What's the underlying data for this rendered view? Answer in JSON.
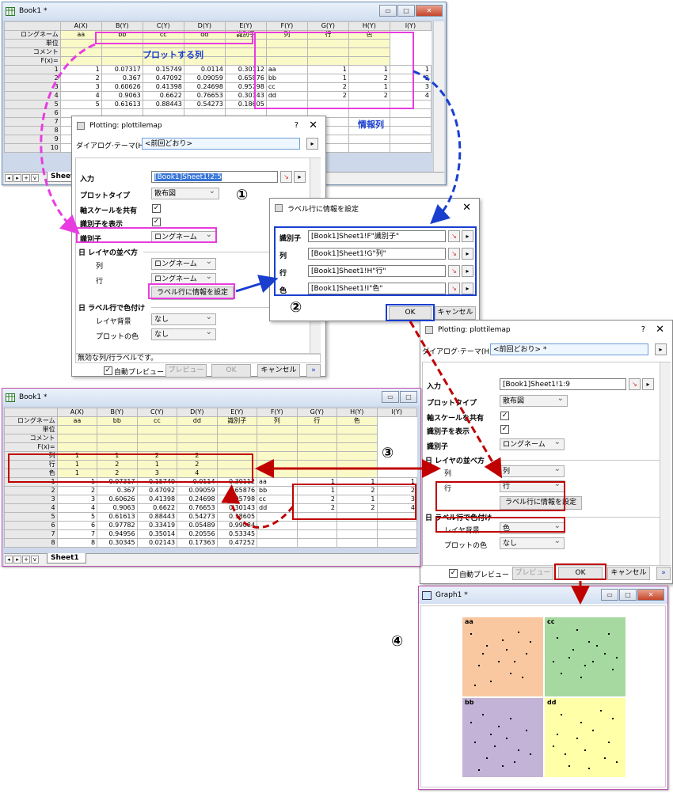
{
  "book_top": {
    "title": "Book1 *",
    "columns": [
      "",
      "A(X)",
      "B(Y)",
      "C(Y)",
      "D(Y)",
      "E(Y)",
      "F(Y)",
      "G(Y)",
      "H(Y)",
      "I(Y)"
    ],
    "meta": [
      {
        "label": "ロングネーム",
        "values": [
          "",
          "aa",
          "bb",
          "cc",
          "dd",
          "識別子",
          "列",
          "行",
          "色"
        ]
      },
      {
        "label": "単位",
        "values": [
          "",
          "",
          "",
          "",
          "",
          "",
          "",
          "",
          ""
        ]
      },
      {
        "label": "コメント",
        "values": [
          "",
          "",
          "",
          "",
          "",
          "",
          "",
          "",
          ""
        ]
      },
      {
        "label": "F(x)=",
        "values": [
          "",
          "",
          "",
          "",
          "",
          "",
          "",
          "",
          ""
        ]
      }
    ],
    "rows": [
      [
        "1",
        "1",
        "0.07317",
        "0.15749",
        "0.0114",
        "0.30112",
        "aa",
        "1",
        "1",
        "1"
      ],
      [
        "2",
        "2",
        "0.367",
        "0.47092",
        "0.09059",
        "0.65876",
        "bb",
        "1",
        "2",
        "2"
      ],
      [
        "3",
        "3",
        "0.60626",
        "0.41398",
        "0.24698",
        "0.95798",
        "cc",
        "2",
        "1",
        "3"
      ],
      [
        "4",
        "4",
        "0.9063",
        "0.6622",
        "0.76653",
        "0.30143",
        "dd",
        "2",
        "2",
        "4"
      ],
      [
        "5",
        "5",
        "0.61613",
        "0.88443",
        "0.54273",
        "0.18605",
        "",
        "",
        "",
        ""
      ],
      [
        "6",
        "",
        "",
        "",
        "",
        "",
        "",
        "",
        "",
        ""
      ],
      [
        "7",
        "",
        "",
        "",
        "",
        "",
        "",
        "",
        "",
        ""
      ],
      [
        "8",
        "",
        "",
        "",
        "",
        "",
        "",
        "",
        "",
        ""
      ],
      [
        "9",
        "",
        "",
        "",
        "",
        "",
        "",
        "",
        "",
        ""
      ],
      [
        "10",
        "",
        "",
        "",
        "",
        "",
        "",
        "",
        "",
        ""
      ]
    ],
    "tab": "Sheet1",
    "ann_plot": "プロットする列",
    "ann_info": "情報列"
  },
  "dlg1": {
    "title": "Plotting: plottilemap",
    "theme_label": "ダイアログ·テーマ(H)",
    "theme_value": "<前回どおり>",
    "input_label": "入力",
    "input_value": "[Book1]Sheet1!2:5",
    "plottype_label": "プロットタイプ",
    "plottype_value": "散布図",
    "share_label": "軸スケールを共有",
    "show_label": "識別子を表示",
    "ident_label": "識別子",
    "ident_value": "ロングネーム",
    "layer_order": "日 レイヤの並べ方",
    "col_label": "列",
    "col_value": "ロングネーム",
    "row_label": "行",
    "row_value": "ロングネーム",
    "setlabel_btn": "ラベル行に情報を設定",
    "color_sec": "日 ラベル行で色付け",
    "bg_label": "レイヤ背景",
    "bg_value": "なし",
    "plotcolor_label": "プロットの色",
    "plotcolor_value": "なし",
    "status": "無効な列/行ラベルです。",
    "autoprev": "自動プレビュー",
    "preview": "プレビュー",
    "ok": "OK",
    "cancel": "キャンセル"
  },
  "dlg2": {
    "title": "ラベル行に情報を設定",
    "rows": [
      {
        "label": "識別子",
        "value": "[Book1]Sheet1!F\"識別子\""
      },
      {
        "label": "列",
        "value": "[Book1]Sheet1!G\"列\""
      },
      {
        "label": "行",
        "value": "[Book1]Sheet1!H\"行\""
      },
      {
        "label": "色",
        "value": "[Book1]Sheet1!I\"色\""
      }
    ],
    "ok": "OK",
    "cancel": "キャンセル"
  },
  "dlg3": {
    "title": "Plotting: plottilemap",
    "theme_label": "ダイアログ·テーマ(H)",
    "theme_value": "<前回どおり> *",
    "input_label": "入力",
    "input_value": "[Book1]Sheet1!1:9",
    "plottype_label": "プロットタイプ",
    "plottype_value": "散布図",
    "share_label": "軸スケールを共有",
    "show_label": "識別子を表示",
    "ident_label": "識別子",
    "ident_value": "ロングネーム",
    "layer_order": "日 レイヤの並べ方",
    "col_label": "列",
    "col_value": "列",
    "row_label": "行",
    "row_value": "行",
    "setlabel_btn": "ラベル行に情報を設定",
    "color_sec": "日 ラベル行で色付け",
    "bg_label": "レイヤ背景",
    "bg_value": "色",
    "plotcolor_label": "プロットの色",
    "plotcolor_value": "なし",
    "autoprev": "自動プレビュー",
    "preview": "プレビュー",
    "ok": "OK",
    "cancel": "キャンセル"
  },
  "book_bottom": {
    "title": "Book1 *",
    "columns": [
      "",
      "A(X)",
      "B(Y)",
      "C(Y)",
      "D(Y)",
      "E(Y)",
      "F(Y)",
      "G(Y)",
      "H(Y)",
      "I(Y)"
    ],
    "meta": [
      {
        "label": "ロングネーム",
        "values": [
          "",
          "aa",
          "bb",
          "cc",
          "dd",
          "識別子",
          "列",
          "行",
          "色"
        ]
      },
      {
        "label": "単位",
        "values": [
          "",
          "",
          "",
          "",
          "",
          "",
          "",
          "",
          ""
        ]
      },
      {
        "label": "コメント",
        "values": [
          "",
          "",
          "",
          "",
          "",
          "",
          "",
          "",
          ""
        ]
      },
      {
        "label": "F(x)=",
        "values": [
          "",
          "",
          "",
          "",
          "",
          "",
          "",
          "",
          ""
        ]
      },
      {
        "label": "列",
        "values": [
          "",
          "1",
          "1",
          "2",
          "2",
          "",
          "",
          "",
          ""
        ]
      },
      {
        "label": "行",
        "values": [
          "",
          "1",
          "2",
          "1",
          "2",
          "",
          "",
          "",
          ""
        ]
      },
      {
        "label": "色",
        "values": [
          "",
          "1",
          "2",
          "3",
          "4",
          "",
          "",
          "",
          ""
        ]
      }
    ],
    "rows": [
      [
        "1",
        "1",
        "0.07317",
        "0.15749",
        "0.0114",
        "0.30112",
        "aa",
        "1",
        "1",
        "1"
      ],
      [
        "2",
        "2",
        "0.367",
        "0.47092",
        "0.09059",
        "0.65876",
        "bb",
        "1",
        "2",
        "2"
      ],
      [
        "3",
        "3",
        "0.60626",
        "0.41398",
        "0.24698",
        "0.95798",
        "cc",
        "2",
        "1",
        "3"
      ],
      [
        "4",
        "4",
        "0.9063",
        "0.6622",
        "0.76653",
        "0.30143",
        "dd",
        "2",
        "2",
        "4"
      ],
      [
        "5",
        "5",
        "0.61613",
        "0.88443",
        "0.54273",
        "0.18605",
        "",
        "",
        "",
        ""
      ],
      [
        "6",
        "6",
        "0.97782",
        "0.33419",
        "0.05489",
        "0.99084",
        "",
        "",
        "",
        ""
      ],
      [
        "7",
        "7",
        "0.94956",
        "0.35014",
        "0.20556",
        "0.53345",
        "",
        "",
        "",
        ""
      ],
      [
        "8",
        "8",
        "0.30345",
        "0.02143",
        "0.17363",
        "0.47252",
        "",
        "",
        "",
        ""
      ]
    ],
    "tab": "Sheet1"
  },
  "graph": {
    "title": "Graph1 *",
    "panels": [
      {
        "label": "aa",
        "color": "#f9c8a0"
      },
      {
        "label": "cc",
        "color": "#a6d9a0"
      },
      {
        "label": "bb",
        "color": "#c3b3d6"
      },
      {
        "label": "dd",
        "color": "#ffffa8"
      }
    ]
  },
  "steps": [
    "①",
    "②",
    "③",
    "④"
  ],
  "colors": {
    "magenta": "#e83ce0",
    "blue": "#1a3fcf",
    "red": "#c00000"
  }
}
